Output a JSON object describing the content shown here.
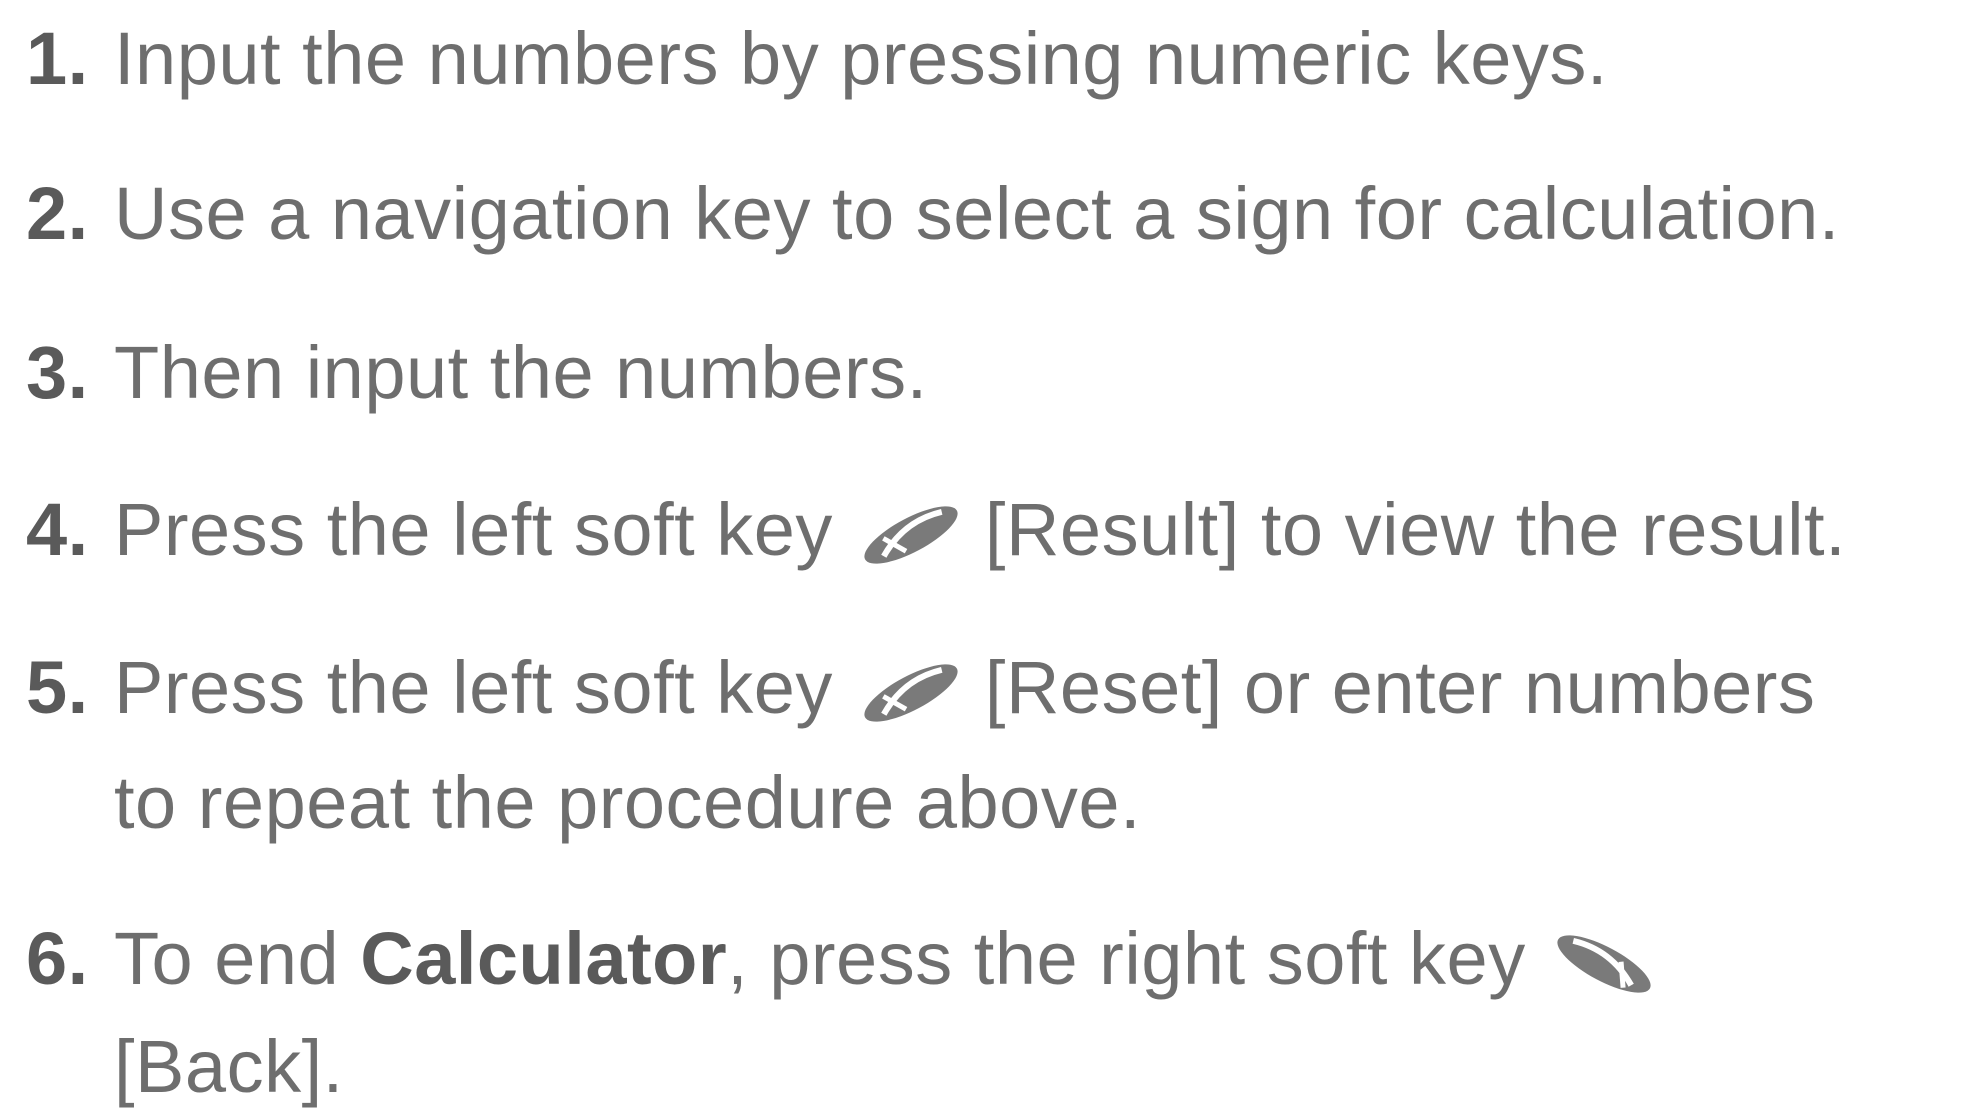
{
  "steps": [
    {
      "num": "1.",
      "text": "Input the numbers by pressing numeric keys."
    },
    {
      "num": "2.",
      "text": "Use a navigation key to select a sign for calculation."
    },
    {
      "num": "3.",
      "text": "Then input the numbers."
    },
    {
      "num": "4.",
      "before": "Press the left soft key",
      "after": "[Result] to view the result.",
      "icon": "left-soft-key-icon"
    },
    {
      "num": "5.",
      "before": "Press the left soft key",
      "after": "[Reset] or enter numbers",
      "cont": "to repeat the procedure above.",
      "icon": "left-soft-key-icon"
    },
    {
      "num": "6.",
      "before": "To end",
      "bold": "Calculator",
      "after": ", press the right soft key",
      "cont": "[Back].",
      "icon": "right-soft-key-icon"
    }
  ],
  "colors": {
    "text": "#6e6e6e",
    "number": "#5a5a5a",
    "icon": "#7a7a7a"
  }
}
